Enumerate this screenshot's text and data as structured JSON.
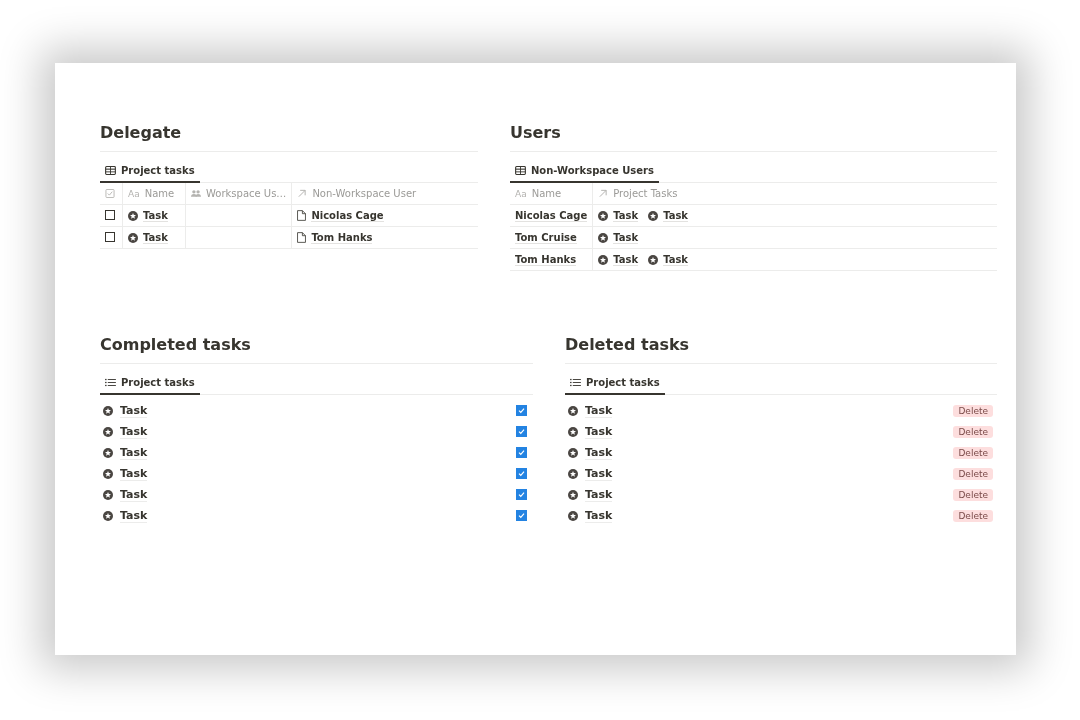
{
  "delegate": {
    "title": "Delegate",
    "view": {
      "label": "Project tasks",
      "kind": "table",
      "selected": true
    },
    "columns": [
      {
        "kind": "checkbox"
      },
      {
        "kind": "title",
        "glyph": "Aa",
        "label": "Name"
      },
      {
        "kind": "person",
        "label": "Workspace Us…"
      },
      {
        "kind": "relation",
        "label": "Non-Workspace User"
      }
    ],
    "rows": [
      {
        "checked": false,
        "name": "Task",
        "user": "Nicolas Cage"
      },
      {
        "checked": false,
        "name": "Task",
        "user": "Tom Hanks"
      }
    ]
  },
  "users": {
    "title": "Users",
    "view": {
      "label": "Non-Workspace Users",
      "kind": "table",
      "selected": true
    },
    "columns": [
      {
        "kind": "title",
        "glyph": "Aa",
        "label": "Name"
      },
      {
        "kind": "relation",
        "label": "Project Tasks"
      }
    ],
    "rows": [
      {
        "name": "Nicolas Cage",
        "tasks": [
          "Task",
          "Task"
        ]
      },
      {
        "name": "Tom Cruise",
        "tasks": [
          "Task"
        ]
      },
      {
        "name": "Tom Hanks",
        "tasks": [
          "Task",
          "Task"
        ]
      }
    ]
  },
  "completed": {
    "title": "Completed tasks",
    "view": {
      "label": "Project tasks",
      "kind": "list",
      "selected": true
    },
    "items": [
      {
        "name": "Task",
        "checked": true
      },
      {
        "name": "Task",
        "checked": true
      },
      {
        "name": "Task",
        "checked": true
      },
      {
        "name": "Task",
        "checked": true
      },
      {
        "name": "Task",
        "checked": true
      },
      {
        "name": "Task",
        "checked": true
      }
    ]
  },
  "deleted": {
    "title": "Deleted tasks",
    "view": {
      "label": "Project tasks",
      "kind": "list",
      "selected": true
    },
    "items": [
      {
        "name": "Task",
        "action": "Delete"
      },
      {
        "name": "Task",
        "action": "Delete"
      },
      {
        "name": "Task",
        "action": "Delete"
      },
      {
        "name": "Task",
        "action": "Delete"
      },
      {
        "name": "Task",
        "action": "Delete"
      },
      {
        "name": "Task",
        "action": "Delete"
      }
    ]
  }
}
